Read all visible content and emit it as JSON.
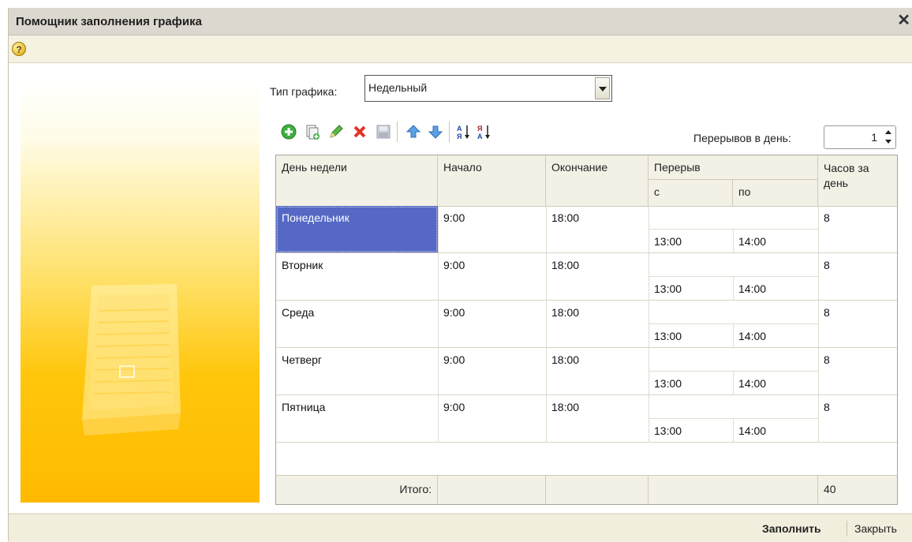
{
  "window": {
    "title": "Помощник заполнения графика"
  },
  "schedule_type": {
    "label": "Тип графика:",
    "value": "Недельный"
  },
  "breaks": {
    "label": "Перерывов в день:",
    "value": "1"
  },
  "toolbar": [
    "add-icon",
    "copy-icon",
    "edit-icon",
    "delete-icon",
    "save-icon",
    "move-up-icon",
    "move-down-icon",
    "sort-asc-icon",
    "sort-desc-icon"
  ],
  "table": {
    "headers": {
      "day": "День недели",
      "start": "Начало",
      "end": "Окончание",
      "break": "Перерыв",
      "break_from": "с",
      "break_to": "по",
      "hours": "Часов за день"
    },
    "rows": [
      {
        "day": "Понедельник",
        "start": "9:00",
        "end": "18:00",
        "break_from": "13:00",
        "break_to": "14:00",
        "hours": "8"
      },
      {
        "day": "Вторник",
        "start": "9:00",
        "end": "18:00",
        "break_from": "13:00",
        "break_to": "14:00",
        "hours": "8"
      },
      {
        "day": "Среда",
        "start": "9:00",
        "end": "18:00",
        "break_from": "13:00",
        "break_to": "14:00",
        "hours": "8"
      },
      {
        "day": "Четверг",
        "start": "9:00",
        "end": "18:00",
        "break_from": "13:00",
        "break_to": "14:00",
        "hours": "8"
      },
      {
        "day": "Пятница",
        "start": "9:00",
        "end": "18:00",
        "break_from": "13:00",
        "break_to": "14:00",
        "hours": "8"
      }
    ],
    "footer": {
      "label": "Итого:",
      "hours_total": "40"
    }
  },
  "buttons": {
    "fill": "Заполнить",
    "close": "Закрыть"
  },
  "colors": {
    "selection": "#5468c4",
    "accent": "#ffc000"
  }
}
